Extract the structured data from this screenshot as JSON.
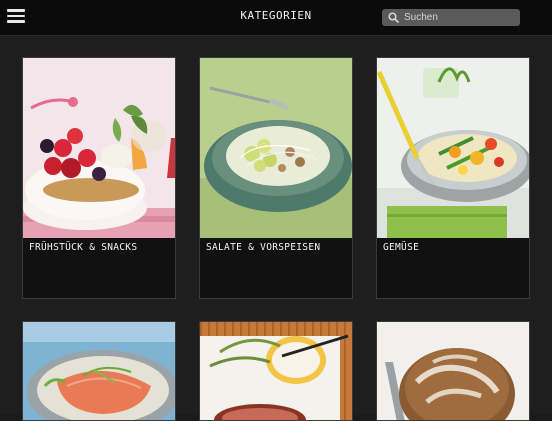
{
  "header": {
    "title": "KATEGORIEN",
    "search_placeholder": "Suchen"
  },
  "categories": [
    {
      "label": "FRÜHSTÜCK & SNACKS",
      "image_icon": "breakfast-berries-yogurt"
    },
    {
      "label": "SALATE & VORSPEISEN",
      "image_icon": "salad-bowl"
    },
    {
      "label": "GEMÜSE",
      "image_icon": "vegetable-pan"
    },
    {
      "label": "",
      "image_icon": "salmon-dish"
    },
    {
      "label": "",
      "image_icon": "roast-with-dip"
    },
    {
      "label": "",
      "image_icon": "bread-loaf"
    }
  ],
  "colors": {
    "topbar": "#0b0b0b",
    "background": "#1e1e1e",
    "card": "#111111",
    "search_field": "#5a5a5a"
  }
}
